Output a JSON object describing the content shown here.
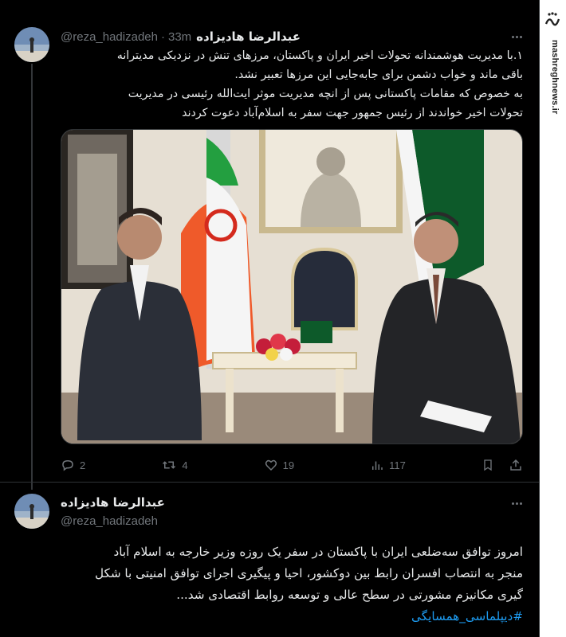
{
  "watermark": {
    "logo_text": "مشرق",
    "url_text": "mashreghnews.ir"
  },
  "tweet1": {
    "author_name": "عبدالرضا هادیزاده",
    "handle": "@reza_hadizadeh",
    "separator": "·",
    "time": "33m",
    "lines": [
      "۱.با مدیریت هوشمندانه تحولات اخیر ایران و پاکستان، مرزهای تنش در نزدیکی مدیترانه",
      "باقی ماند و خواب دشمن برای جابه‌جایی این مرزها تعبیر نشد.",
      "به خصوص که مقامات پاکستانی پس از انچه مدیریت موثر ایت‌الله رئیسی در مدیریت",
      "تحولات اخیر خواندند از رئیس جمهور جهت سفر به اسلام‌آباد دعوت کردند"
    ],
    "stats": {
      "replies": "2",
      "retweets": "4",
      "likes": "19",
      "views": "117"
    }
  },
  "tweet2": {
    "author_name": "عبدالرضا هادیزاده",
    "handle": "@reza_hadizadeh",
    "lines": [
      "امروز توافق سه‌ضلعی ایران با پاکستان در سفر یک روزه وزیر خارجه به اسلام آباد",
      "منجر به انتصاب افسران رابط بین دوکشور، احیا و پیگیری اجرای توافق امنیتی با شکل",
      "گیری مکانیزم مشورتی در سطح عالی و توسعه روابط اقتصادی شد..."
    ],
    "hashtag": "#دیپلماسی_همسایگی"
  },
  "colors": {
    "background": "#000000",
    "text": "#e7e9ea",
    "muted": "#71767b",
    "link": "#1d9bf0",
    "border": "#2f3336"
  },
  "icons": [
    "reply-icon",
    "retweet-icon",
    "like-icon",
    "views-icon",
    "bookmark-icon",
    "share-icon",
    "more-icon"
  ]
}
